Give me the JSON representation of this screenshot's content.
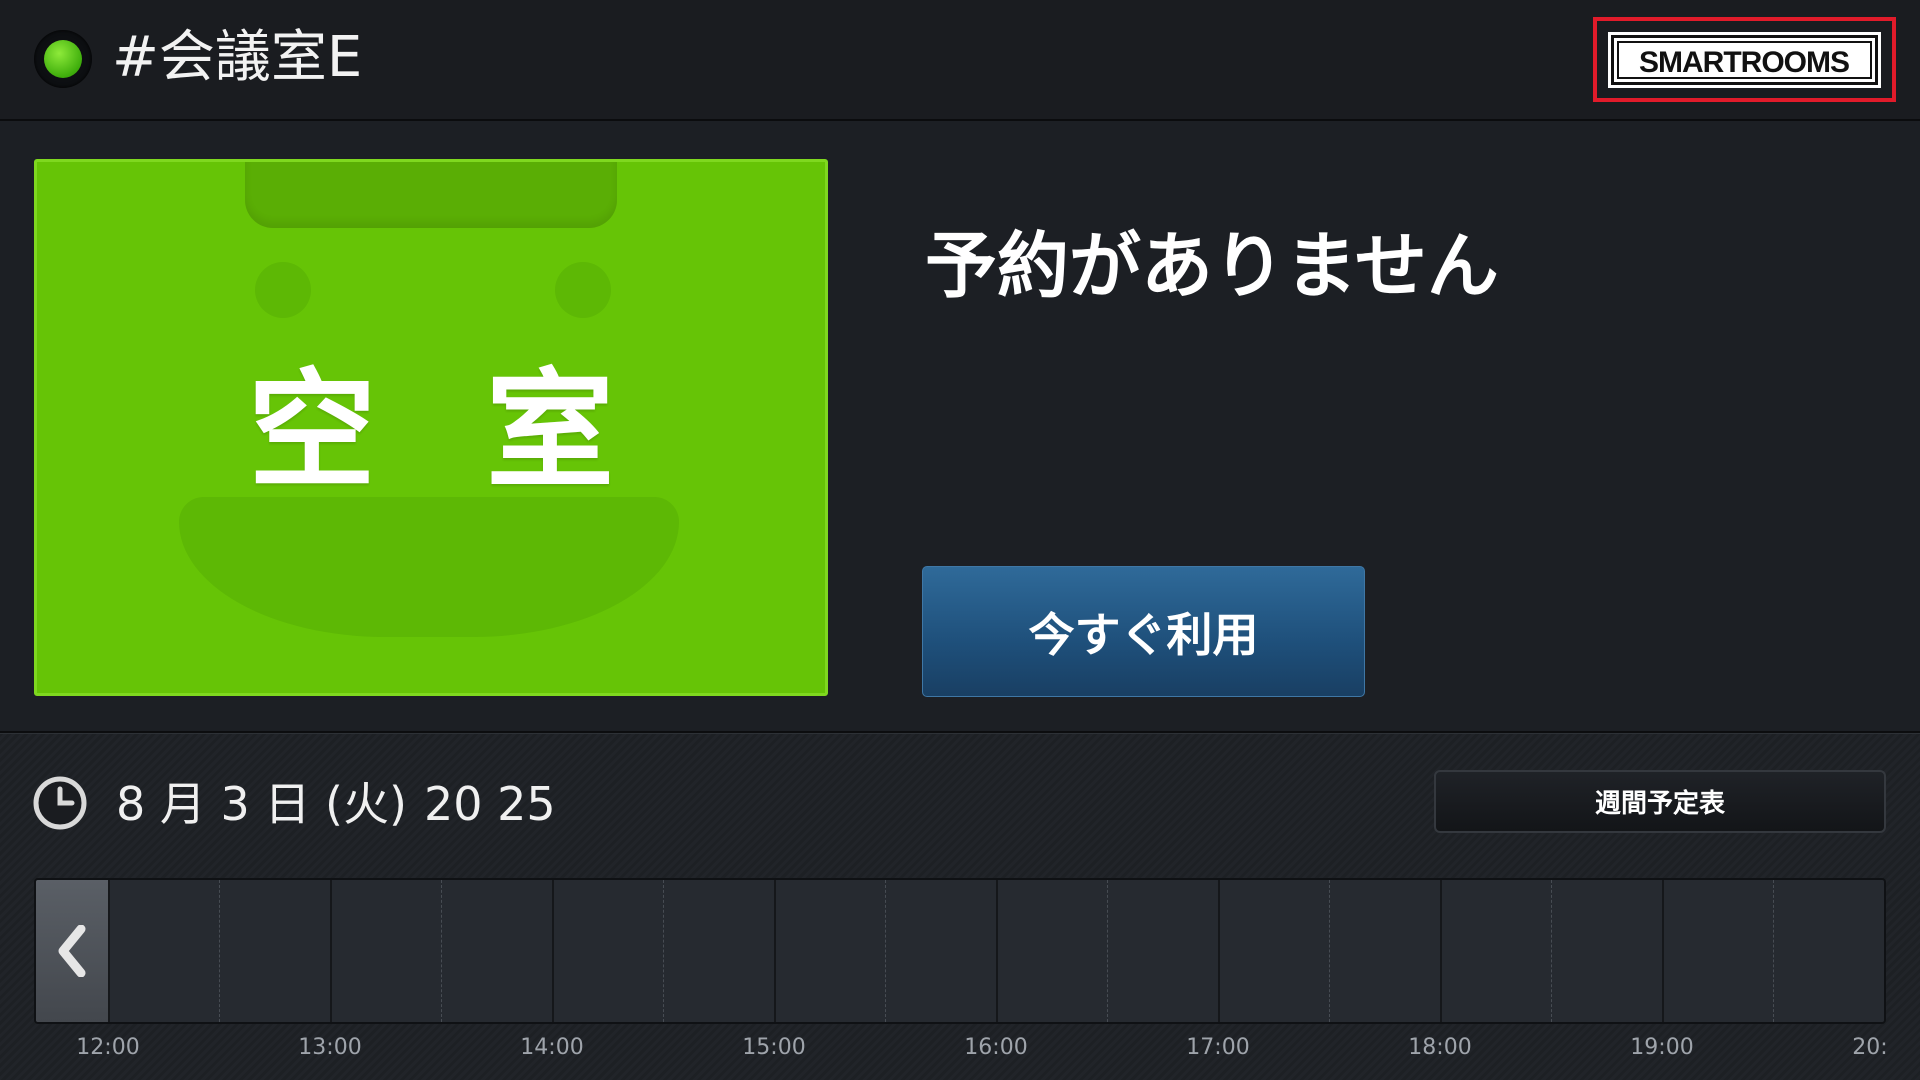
{
  "header": {
    "room_name": "#会議室E",
    "status_color": "#4ccc14",
    "logo_text": "SMARTROOMS",
    "logo_highlight_color": "#e11b2a"
  },
  "main": {
    "status_label": "空室",
    "status_color": "#66c406",
    "reservation_message": "予約がありません",
    "use_now_label": "今すぐ利用"
  },
  "footer": {
    "date": "8 月 3 日 (火)",
    "time": "20 25",
    "weekly_schedule_label": "週間予定表",
    "timeline_hours": [
      "12:00",
      "13:00",
      "14:00",
      "15:00",
      "16:00",
      "17:00",
      "18:00",
      "19:00",
      "20:"
    ]
  }
}
